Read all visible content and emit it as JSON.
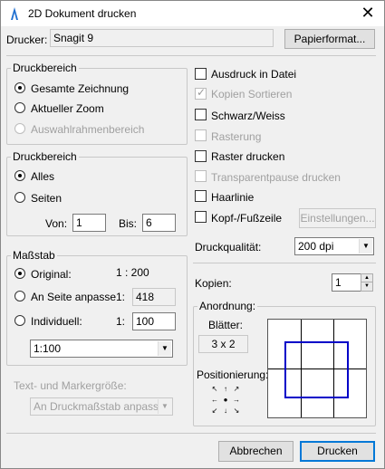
{
  "window": {
    "title": "2D Dokument drucken"
  },
  "printer": {
    "label": "Drucker:",
    "value": "Snagit 9",
    "paper_button": "Papierformat..."
  },
  "print_area": {
    "title": "Druckbereich",
    "options": [
      "Gesamte Zeichnung",
      "Aktueller Zoom",
      "Auswahlrahmenbereich"
    ]
  },
  "page_range": {
    "title": "Druckbereich",
    "all": "Alles",
    "pages": "Seiten",
    "from_label": "Von:",
    "from_value": "1",
    "to_label": "Bis:",
    "to_value": "6"
  },
  "scale": {
    "title": "Maßstab",
    "original_label": "Original:",
    "original_value": "1 : 200",
    "fit_label": "An Seite anpasse",
    "fit_prefix": "1:",
    "fit_value": "418",
    "custom_label": "Individuell:",
    "custom_prefix": "1:",
    "custom_value": "100",
    "dropdown_value": "1:100"
  },
  "text_marker": {
    "label": "Text- und Markergröße:",
    "dropdown_value": "An Druckmaßstab anpassen"
  },
  "options": {
    "to_file": "Ausdruck in Datei",
    "collate": "Kopien Sortieren",
    "bw": "Schwarz/Weiss",
    "raster": "Rasterung",
    "print_raster": "Raster drucken",
    "transparent": "Transparentpause drucken",
    "hairline": "Haarlinie",
    "header_footer": "Kopf-/Fußzeile",
    "settings_button": "Einstellungen..."
  },
  "quality": {
    "label": "Druckqualität:",
    "value": "200 dpi"
  },
  "copies": {
    "label": "Kopien:",
    "value": "1"
  },
  "layout": {
    "title": "Anordnung:",
    "sheets_label": "Blätter:",
    "sheets_value": "3 x 2",
    "position_label": "Positionierung:"
  },
  "buttons": {
    "cancel": "Abbrechen",
    "print": "Drucken"
  },
  "colors": {
    "accent": "#0078d7",
    "preview_page": "#0000c8"
  },
  "icons": {
    "title_icon": "app-pen-icon",
    "close": "close-icon"
  }
}
